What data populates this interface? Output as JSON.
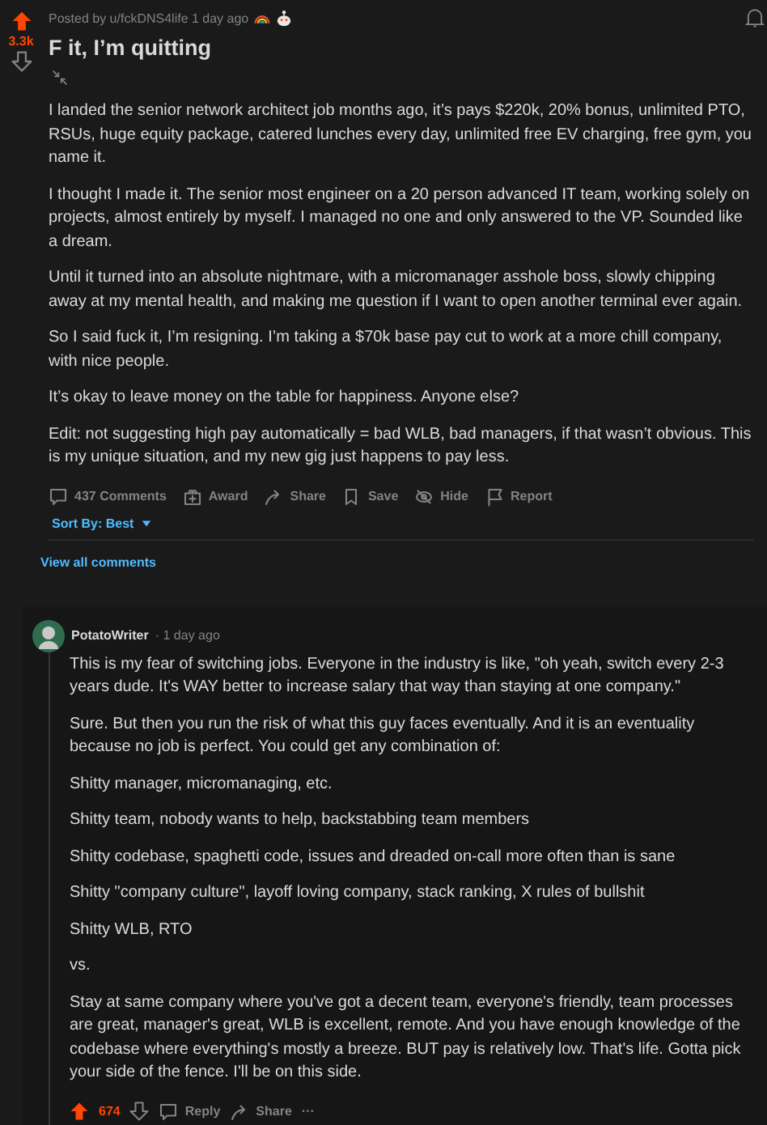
{
  "post": {
    "posted_by": "Posted by u/fckDNS4life 1 day ago",
    "score": "3.3k",
    "upvoted": true,
    "title": "F it, I’m quitting",
    "paragraphs": [
      "I landed the senior network architect job months ago, it’s pays $220k, 20% bonus, unlimited PTO, RSUs, huge equity package, catered lunches every day, unlimited free EV charging, free gym, you name it.",
      "I thought I made it. The senior most engineer on a 20 person advanced IT team, working solely on projects, almost entirely by myself. I managed no one and only answered to the VP. Sounded like a dream.",
      "Until it turned into an absolute nightmare, with a micromanager asshole boss, slowly chipping away at my mental health, and making me question if I want to open another terminal ever again.",
      "So I said fuck it, I’m resigning. I’m taking a $70k base pay cut to work at a more chill company, with nice people.",
      "It’s okay to leave money on the table for happiness. Anyone else?",
      "Edit: not suggesting high pay automatically = bad WLB, bad managers, if that wasn’t obvious. This is my unique situation, and my new gig just happens to pay less."
    ],
    "actions": [
      {
        "kind": "comments",
        "label": "437 Comments"
      },
      {
        "kind": "award",
        "label": "Award"
      },
      {
        "kind": "share",
        "label": "Share"
      },
      {
        "kind": "save",
        "label": "Save"
      },
      {
        "kind": "hide",
        "label": "Hide"
      },
      {
        "kind": "report",
        "label": "Report"
      }
    ],
    "sort_label": "Sort By: Best",
    "view_all": "View all comments"
  },
  "comment": {
    "author": "PotatoWriter",
    "time": "· 1 day ago",
    "score": "674",
    "upvoted": true,
    "paragraphs": [
      "This is my fear of switching jobs. Everyone in the industry is like, \"oh yeah, switch every 2-3 years dude. It's WAY better to increase salary that way than staying at one company.\"",
      "Sure. But then you run the risk of what this guy faces eventually. And it is an eventuality because no job is perfect. You could get any combination of:",
      "Shitty manager, micromanaging, etc.",
      "Shitty team, nobody wants to help, backstabbing team members",
      "Shitty codebase, spaghetti code, issues and dreaded on-call more often than is sane",
      "Shitty \"company culture\", layoff loving company, stack ranking, X rules of bullshit",
      "Shitty WLB, RTO",
      "vs.",
      "Stay at same company where you've got a decent team, everyone's friendly, team processes are great, manager's great, WLB is excellent, remote. And you have enough knowledge of the codebase where everything's mostly a breeze. BUT pay is relatively low. That's life. Gotta pick your side of the fence. I'll be on this side."
    ],
    "actions": [
      {
        "kind": "reply",
        "label": "Reply"
      },
      {
        "kind": "share",
        "label": "Share"
      },
      {
        "kind": "more",
        "label": "···"
      }
    ]
  }
}
